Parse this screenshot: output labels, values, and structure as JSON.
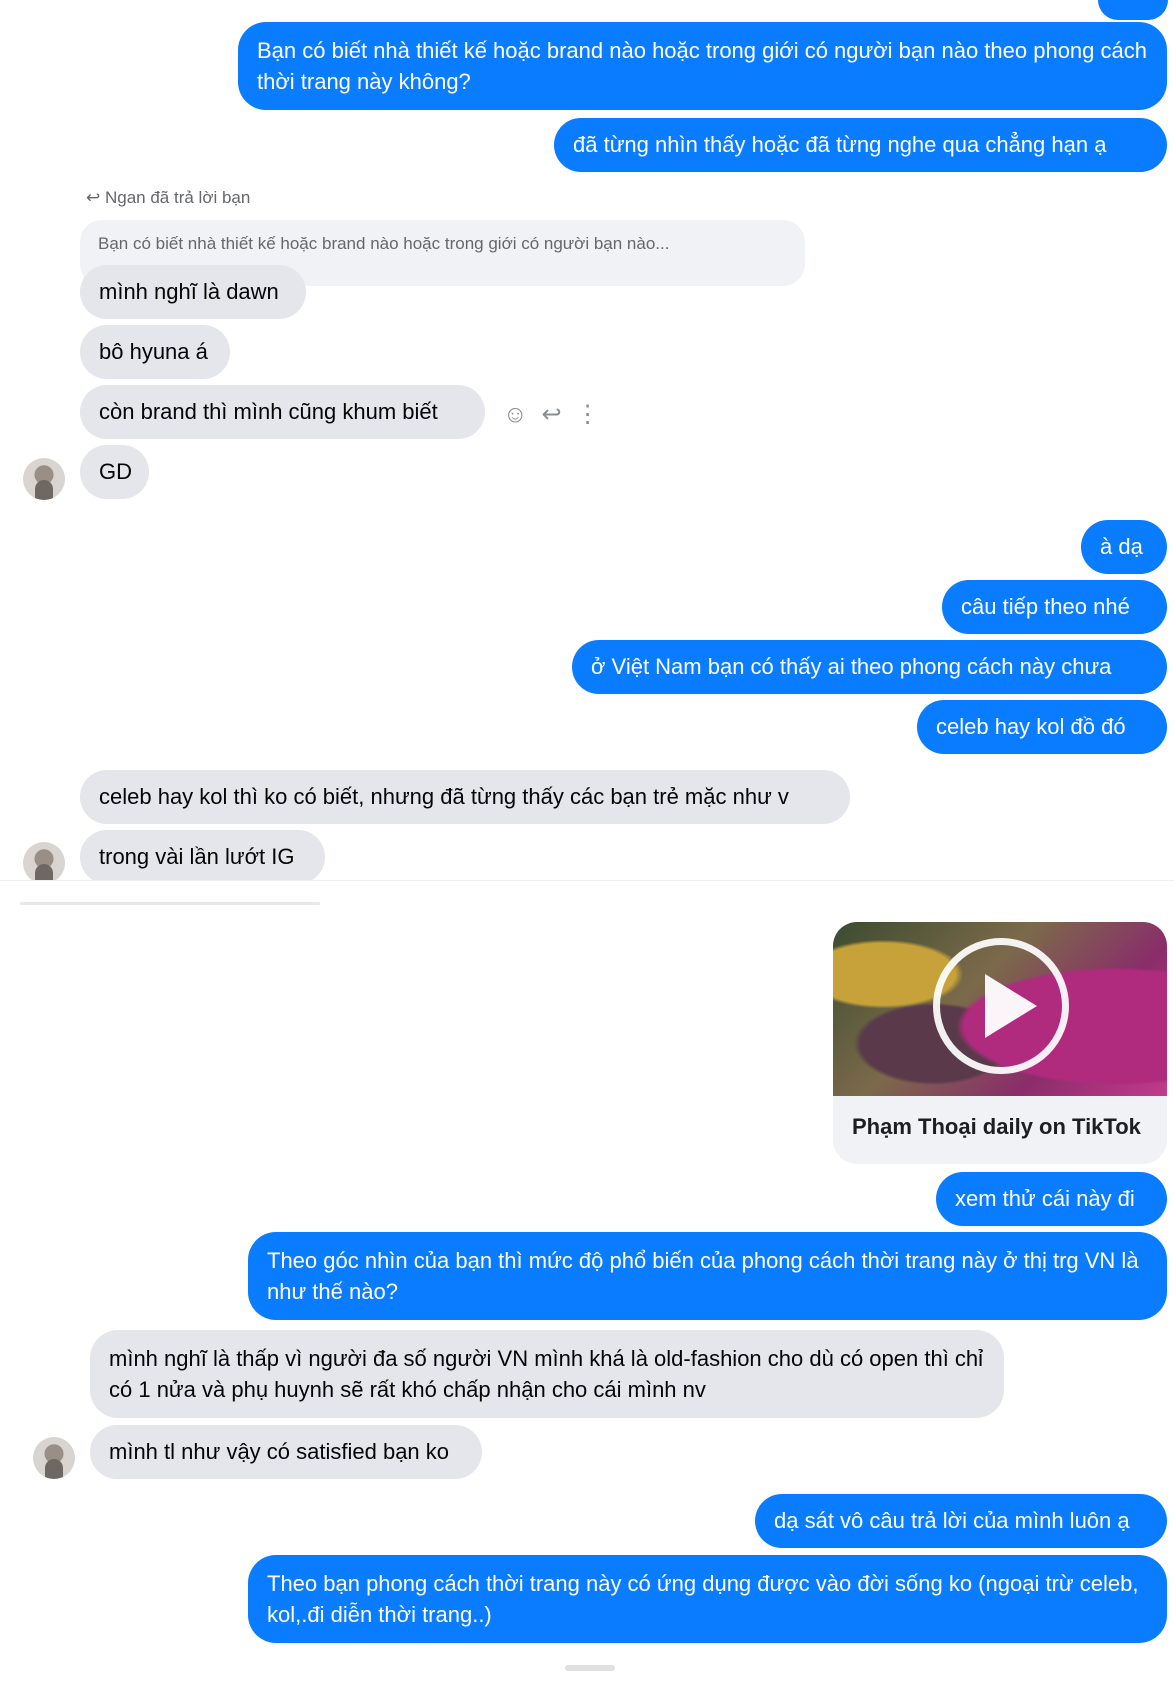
{
  "colors": {
    "outgoing": "#0a7cff",
    "incoming": "#e4e6eb"
  },
  "messages": {
    "m1": "Bạn có biết nhà thiết kế hoặc brand nào hoặc trong giới có người bạn nào theo phong cách thời trang này không?",
    "m2": "đã từng nhìn thấy hoặc đã từng nghe qua chẳng hạn ạ",
    "reply_meta": "Ngan đã trả lời bạn",
    "quoted": "Bạn có biết nhà thiết kế hoặc brand nào hoặc trong giới có người bạn nào...",
    "m3": "mình nghĩ là dawn",
    "m4": "bô hyuna á",
    "m5": "còn brand thì mình cũng khum biết",
    "m6": "GD",
    "m7": "à dạ",
    "m8": "câu tiếp theo nhé",
    "m9": "ở Việt Nam bạn có thấy ai theo phong cách này chưa",
    "m10": "celeb hay kol đồ đó",
    "m11": "celeb hay kol thì ko có biết, nhưng đã từng thấy các bạn trẻ mặc như v",
    "m12": "trong vài lần lướt IG",
    "tiktok_caption": "Phạm Thoại daily on TikTok",
    "m13": "xem thử cái này đi",
    "m14": "Theo góc nhìn của bạn thì mức độ phổ biến của phong cách thời trang này ở thị trg VN  là như thế nào?",
    "m15": "mình nghĩ là thấp vì người đa số người VN mình khá là old-fashion cho dù có open thì chỉ có 1 nửa và phụ huynh sẽ rất khó chấp nhận cho cái mình nv",
    "m16": "mình tl như vậy có satisfied bạn ko",
    "m17": "dạ sát vô câu trả lời của mình luôn ạ",
    "m18": "Theo bạn phong cách thời trang này có ứng dụng được vào đời sống ko (ngoại trừ celeb, kol,.đi diễn thời trang..)"
  },
  "icons": {
    "reply_meta": "reply-arrow-icon",
    "react": "smiley-icon",
    "reply": "reply-icon",
    "more": "more-vertical-icon"
  }
}
